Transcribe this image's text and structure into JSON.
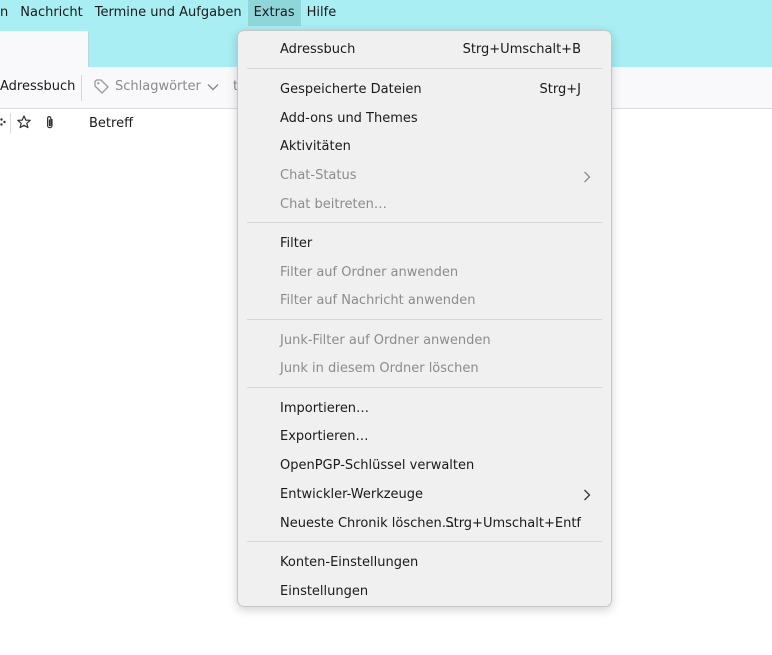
{
  "menubar": {
    "items": [
      {
        "label": "n"
      },
      {
        "label": "Nachricht"
      },
      {
        "label": "Termine und Aufgaben"
      },
      {
        "label": "Extras"
      },
      {
        "label": "Hilfe"
      }
    ]
  },
  "toolbar": {
    "address_book": "Adressbuch",
    "tags": "Schlagwörter",
    "more": "t"
  },
  "columns": {
    "subject": "Betreff"
  },
  "extras_menu": {
    "items": [
      {
        "label": "Adressbuch",
        "shortcut": "Strg+Umschalt+B"
      },
      {
        "label": "Gespeicherte Dateien",
        "shortcut": "Strg+J"
      },
      {
        "label": "Add-ons und Themes"
      },
      {
        "label": "Aktivitäten"
      },
      {
        "label": "Chat-Status"
      },
      {
        "label": "Chat beitreten…"
      },
      {
        "label": "Filter"
      },
      {
        "label": "Filter auf Ordner anwenden"
      },
      {
        "label": "Filter auf Nachricht anwenden"
      },
      {
        "label": "Junk-Filter auf Ordner anwenden"
      },
      {
        "label": "Junk in diesem Ordner löschen"
      },
      {
        "label": "Importieren…"
      },
      {
        "label": "Exportieren…"
      },
      {
        "label": "OpenPGP-Schlüssel verwalten"
      },
      {
        "label": "Entwickler-Werkzeuge"
      },
      {
        "label": "Neueste Chronik löschen…",
        "shortcut": "Strg+Umschalt+Entf"
      },
      {
        "label": "Konten-Einstellungen"
      },
      {
        "label": "Einstellungen"
      }
    ]
  }
}
